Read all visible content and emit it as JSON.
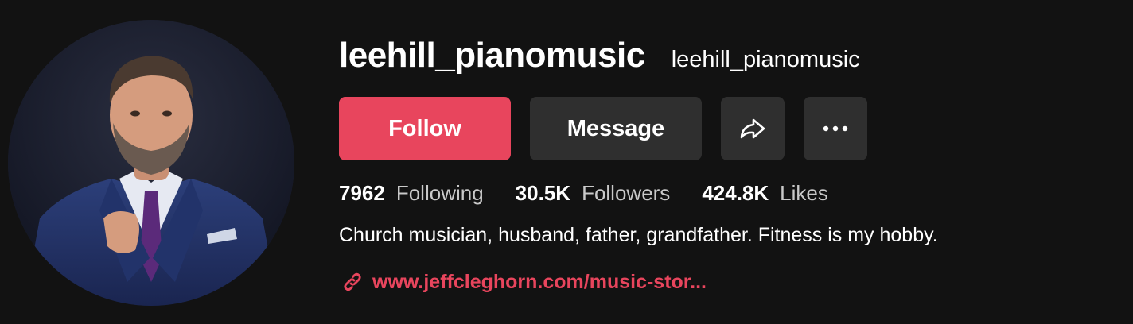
{
  "profile": {
    "username": "leehill_pianomusic",
    "nickname": "leehill_pianomusic",
    "avatar_alt": "profile photo"
  },
  "actions": {
    "follow_label": "Follow",
    "message_label": "Message",
    "share_icon": "share-icon",
    "more_icon": "more-icon"
  },
  "stats": [
    {
      "value": "7962",
      "label": "Following"
    },
    {
      "value": "30.5K",
      "label": "Followers"
    },
    {
      "value": "424.8K",
      "label": "Likes"
    }
  ],
  "bio": "Church musician, husband, father, grandfather. Fitness is my hobby.",
  "link": {
    "icon": "link-icon",
    "text": "www.jeffcleghorn.com/music-stor..."
  },
  "colors": {
    "background": "#121212",
    "accent": "#e8455d",
    "button_secondary": "#2f2f2f",
    "text_muted": "#c9c9c9"
  }
}
